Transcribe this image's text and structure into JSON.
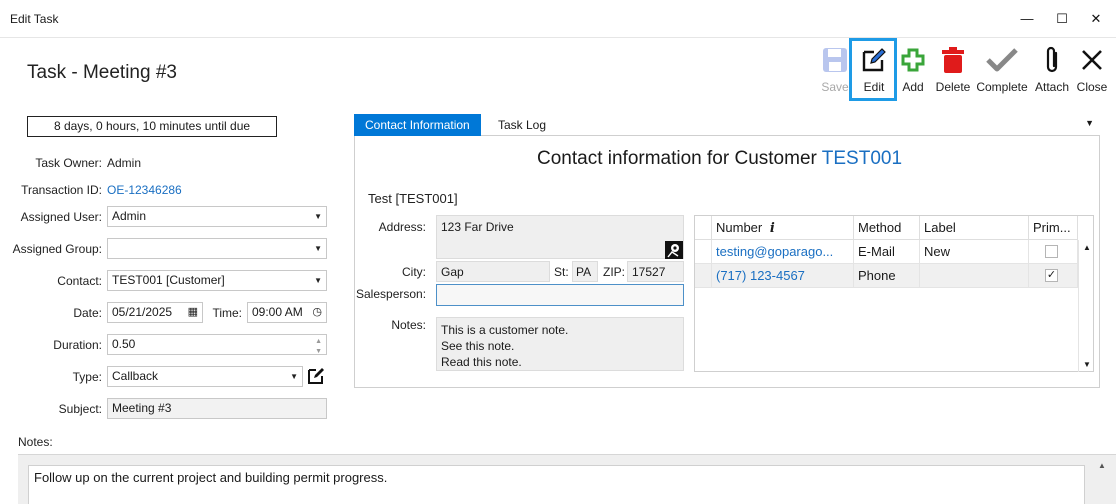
{
  "window": {
    "title": "Edit Task",
    "minimize": "—",
    "maximize": "☐",
    "close": "✕"
  },
  "task_title": "Task - Meeting #3",
  "toolbar": {
    "save": "Save",
    "edit": "Edit",
    "add": "Add",
    "delete": "Delete",
    "complete": "Complete",
    "attach": "Attach",
    "close": "Close"
  },
  "due": "8 days, 0 hours, 10 minutes until due",
  "form": {
    "task_owner_label": "Task Owner:",
    "task_owner": "Admin",
    "transaction_label": "Transaction ID:",
    "transaction_id": "OE-12346286",
    "assigned_user_label": "Assigned User:",
    "assigned_user": "Admin",
    "assigned_group_label": "Assigned Group:",
    "assigned_group": "",
    "contact_label": "Contact:",
    "contact": "TEST001 [Customer]",
    "date_label": "Date:",
    "date": "05/21/2025",
    "time_label": "Time:",
    "time": "09:00 AM",
    "duration_label": "Duration:",
    "duration": "0.50",
    "type_label": "Type:",
    "type": "Callback",
    "subject_label": "Subject:",
    "subject": "Meeting #3"
  },
  "tabs": {
    "contact_info": "Contact Information",
    "task_log": "Task Log"
  },
  "contact": {
    "heading": "Contact information for Customer",
    "heading_id": "TEST001",
    "name": "Test [TEST001]",
    "address_label": "Address:",
    "address": "123 Far Drive",
    "city_label": "City:",
    "city": "Gap",
    "st_label": "St:",
    "st": "PA",
    "zip_label": "ZIP:",
    "zip": "17527",
    "salesperson_label": "Salesperson:",
    "salesperson": "",
    "notes_label": "Notes:",
    "notes_line1": "This is a customer note.",
    "notes_line2": "See this note.",
    "notes_line3": "Read this note."
  },
  "grid": {
    "headers": {
      "number": "Number",
      "info": "i",
      "method": "Method",
      "label": "Label",
      "primary": "Prim..."
    },
    "rows": [
      {
        "number": "testing@goparago...",
        "method": "E-Mail",
        "label": "New",
        "primary": false
      },
      {
        "number": "(717) 123-4567",
        "method": "Phone",
        "label": "",
        "primary": true
      }
    ],
    "check_mark": "✓"
  },
  "notes": {
    "label": "Notes:",
    "text": "Follow up on the current project and building permit progress."
  },
  "colors": {
    "accent": "#0078d7",
    "link": "#1a6fc2",
    "add_green": "#3aa53a",
    "delete_red": "#e01b1b",
    "highlight": "#1e9be6"
  }
}
